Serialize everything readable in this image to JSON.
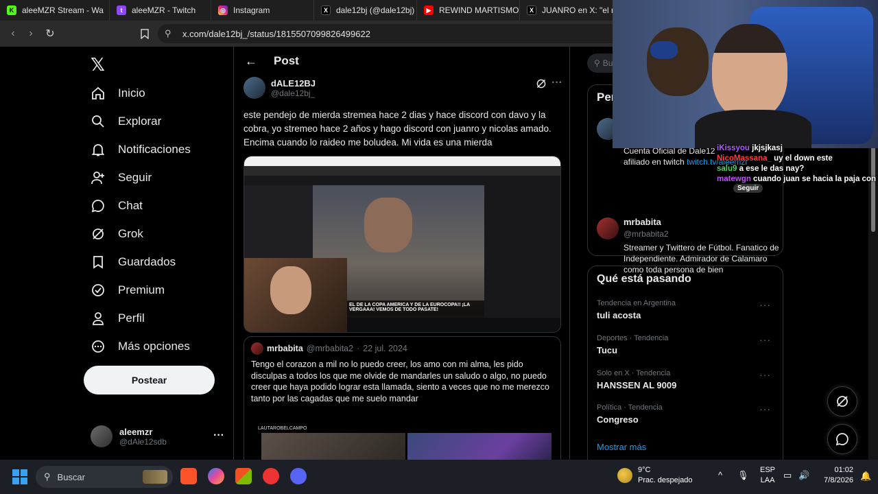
{
  "browser": {
    "tabs": [
      {
        "label": "aleeMZR Stream - Wa",
        "icon": "kick-icon",
        "color": "#53fc18"
      },
      {
        "label": "aleeMZR - Twitch",
        "icon": "twitch-icon",
        "color": "#9146ff"
      },
      {
        "label": "Instagram",
        "icon": "instagram-icon",
        "color": "#e1306c"
      },
      {
        "label": "dale12bj (@dale12bj)",
        "icon": "x-icon",
        "color": "#000000"
      },
      {
        "label": "REWIND MARTISMO",
        "icon": "youtube-icon",
        "color": "#ff0000"
      },
      {
        "label": "JUANRO en X: \"el má",
        "icon": "x-icon",
        "color": "#000000"
      }
    ],
    "url": "x.com/dale12bj_/status/1815507099826499622"
  },
  "sidebar": {
    "logo": "𝕏",
    "items": [
      {
        "label": "Inicio",
        "icon": "home-icon"
      },
      {
        "label": "Explorar",
        "icon": "search-icon"
      },
      {
        "label": "Notificaciones",
        "icon": "bell-icon"
      },
      {
        "label": "Seguir",
        "icon": "follow-icon"
      },
      {
        "label": "Chat",
        "icon": "chat-icon"
      },
      {
        "label": "Grok",
        "icon": "grok-icon"
      },
      {
        "label": "Guardados",
        "icon": "bookmark-icon"
      },
      {
        "label": "Premium",
        "icon": "premium-icon"
      },
      {
        "label": "Perfil",
        "icon": "profile-icon"
      },
      {
        "label": "Más opciones",
        "icon": "more-icon"
      }
    ],
    "post_button": "Postear",
    "account": {
      "name": "aleemzr",
      "handle": "@dAle12sdb"
    }
  },
  "post": {
    "header": "Post",
    "author_name": "dALE12BJ",
    "author_handle": "@dale12bj_",
    "text": "este pendejo de mierda stremea hace 2 dias y hace discord con davo y la cobra, yo stremeo hace 2 años y hago discord con juanro y nicolas amado. Encima cuando lo raideo me boludea. Mi vida es una mierda",
    "media_caption": "EL DE LA COPA AMERICA Y DE LA EUROCOPA!! ¡LA VERGAAA! VEMOS DE TODO PASATE!",
    "quote": {
      "name": "mrbabita",
      "handle": "@mrbabita2",
      "date": "22 jul. 2024",
      "text": "Tengo el corazon a mil no lo puedo creer, los amo con mi alma, les pido disculpas a todos los que me olvide de mandarles un saludo o algo, no puedo creer que haya podido lograr esta llamada, siento a veces que no me merezco tanto por las cagadas que me suelo mandar",
      "media_label": "LAUTAROBELCAMPO"
    }
  },
  "right": {
    "search_placeholder": "Bu",
    "people_title": "Per",
    "person1_bio": "Cuenta Oficial de Dale12",
    "person1_bio2": "afiliado en twitch",
    "person1_link": "twitch.tv/aleemzr",
    "person2": {
      "name": "mrbabita",
      "handle": "@mrbabita2",
      "bio": "Streamer y Twittero de Fútbol. Fanatico de Independiente. Admirador de Calamaro como toda persona de bien"
    },
    "trends_title": "Qué está pasando",
    "trends": [
      {
        "meta": "Tendencia en Argentina",
        "name": "tuli acosta"
      },
      {
        "meta": "Deportes · Tendencia",
        "name": "Tucu"
      },
      {
        "meta": "Solo en X · Tendencia",
        "name": "HANSSEN AL 9009"
      },
      {
        "meta": "Política · Tendencia",
        "name": "Congreso"
      }
    ],
    "show_more": "Mostrar más"
  },
  "stream_chat": [
    {
      "user": "iKissyou",
      "msg": "jkjsjkasj",
      "color": "#b05cff"
    },
    {
      "user": "NicoMassana_",
      "msg": "uy el down este",
      "color": "#ff3b3b"
    },
    {
      "user": "salu9",
      "msg": "a ese le das nay?",
      "color": "#4fd35b"
    },
    {
      "user": "matewgn",
      "msg": "cuando juan se hacia la paja con ese",
      "color": "#c64bff"
    }
  ],
  "stream_follow_badge": "Seguir",
  "taskbar": {
    "search": "Buscar",
    "weather_temp": "9°C",
    "weather_desc": "Prac. despejado",
    "lang1": "ESP",
    "lang2": "LAA",
    "time": "01:02",
    "date": "7/8/2026"
  },
  "colors": {
    "link": "#1d9bf0",
    "text": "#e7e9ea",
    "muted": "#71767b",
    "border": "#2f3336"
  }
}
